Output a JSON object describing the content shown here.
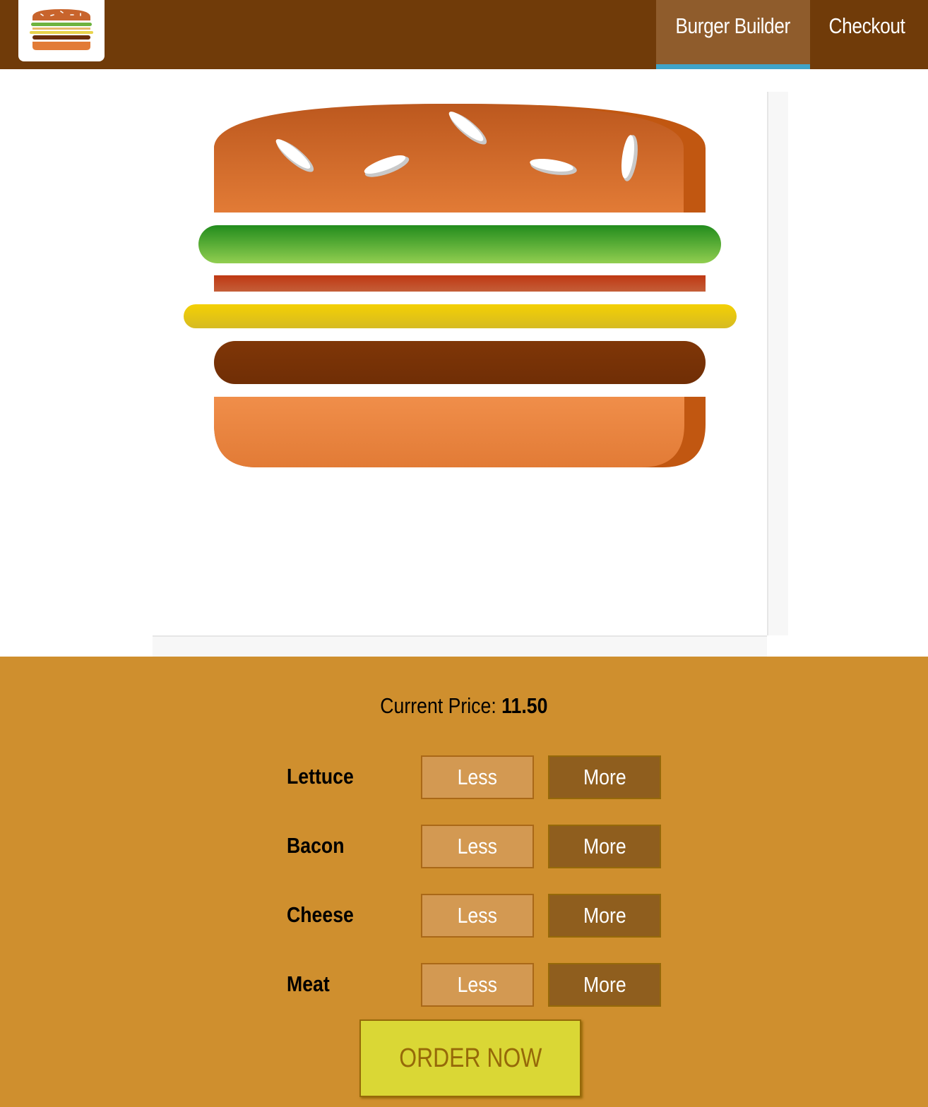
{
  "toolbar": {
    "nav": [
      {
        "label": "Burger Builder",
        "active": true
      },
      {
        "label": "Checkout",
        "active": false
      }
    ]
  },
  "controls": {
    "price_label": "Current Price: ",
    "price_value": "11.50",
    "ingredients": [
      {
        "label": "Lettuce",
        "less": "Less",
        "more": "More"
      },
      {
        "label": "Bacon",
        "less": "Less",
        "more": "More"
      },
      {
        "label": "Cheese",
        "less": "Less",
        "more": "More"
      },
      {
        "label": "Meat",
        "less": "Less",
        "more": "More"
      }
    ],
    "order_label": "ORDER NOW"
  },
  "colors": {
    "toolbar": "#703B09",
    "active_tab": "#8F5C2C",
    "active_underline": "#40A4C8",
    "controls_bg": "#CF8F2E",
    "less_btn": "#D39952",
    "more_btn": "#8F5E1E",
    "order_btn": "#DAD735",
    "bread": "#E27B36",
    "lettuce": "#7BC142",
    "bacon": "#BF3813",
    "cheese": "#F4D004",
    "meat": "#7F3608"
  },
  "icons": {
    "logo": "burger-logo-icon"
  }
}
